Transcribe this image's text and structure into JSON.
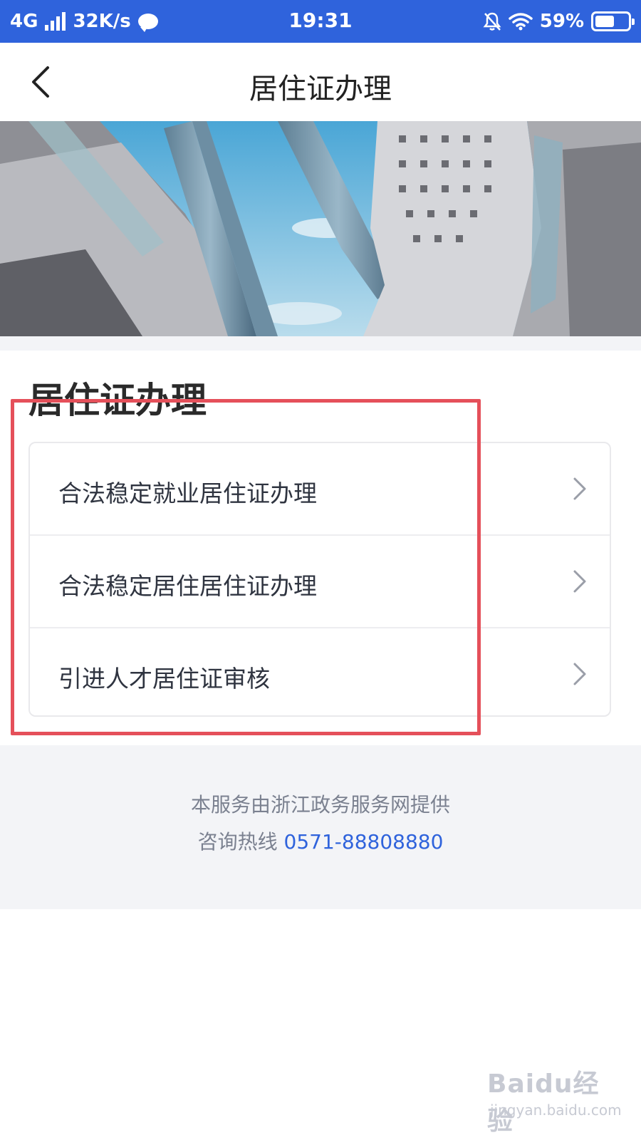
{
  "status_bar": {
    "network": "4G",
    "speed": "32K/s",
    "time": "19:31",
    "battery": "59%",
    "battery_level": 0.59,
    "icons": [
      "signal-icon",
      "chat-icon",
      "mute-bell-icon",
      "wifi-icon",
      "battery-icon"
    ]
  },
  "header": {
    "title": "居住证办理",
    "back_icon": "chevron-left-icon"
  },
  "banner": {
    "icon": "city-skyline-image"
  },
  "section": {
    "title": "居住证办理",
    "items": [
      {
        "label": "合法稳定就业居住证办理",
        "icon": "chevron-right-icon"
      },
      {
        "label": "合法稳定居住居住证办理",
        "icon": "chevron-right-icon"
      },
      {
        "label": "引进人才居住证审核",
        "icon": "chevron-right-icon"
      }
    ]
  },
  "footer": {
    "provider": "本服务由浙江政务服务网提供",
    "hotline_label": "咨询热线",
    "hotline_number": "0571-88808880"
  },
  "watermark": {
    "logo": "Baidu经验",
    "site": "jingyan.baidu.com"
  },
  "colors": {
    "status_bar": "#2f63dc",
    "highlight": "#e5505a",
    "link": "#2f63dc"
  }
}
